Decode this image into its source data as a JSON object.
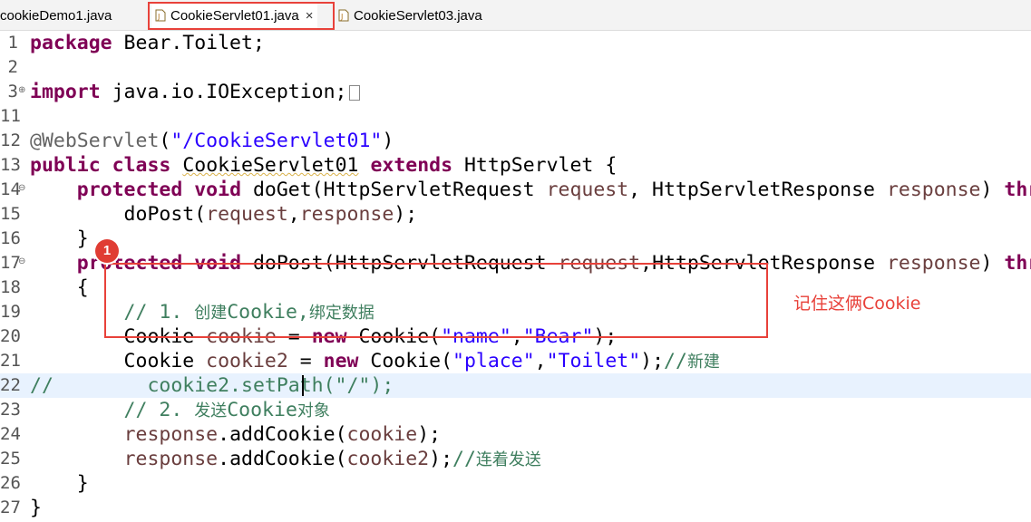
{
  "tabs": [
    {
      "label": "cookieDemo1.java",
      "active": false
    },
    {
      "label": "CookieServlet01.java",
      "active": true,
      "close_glyph": "×"
    },
    {
      "label": "CookieServlet03.java",
      "active": false
    }
  ],
  "editor": {
    "lines": [
      {
        "number": "1",
        "parts": [
          {
            "t": "package",
            "c": "kw"
          },
          {
            "t": " Bear.Toilet;"
          }
        ]
      },
      {
        "number": "2",
        "parts": []
      },
      {
        "number": "3",
        "fold": "⊕",
        "parts": [
          {
            "t": "import",
            "c": "kw"
          },
          {
            "t": " java.io.IOException;"
          }
        ],
        "folded": true
      },
      {
        "number": "11",
        "parts": []
      },
      {
        "number": "12",
        "parts": [
          {
            "t": "@WebServlet",
            "c": "ann"
          },
          {
            "t": "("
          },
          {
            "t": "\"/CookieServlet01\"",
            "c": "str"
          },
          {
            "t": ")"
          }
        ]
      },
      {
        "number": "13",
        "parts": [
          {
            "t": "public",
            "c": "kw"
          },
          {
            "t": " "
          },
          {
            "t": "class",
            "c": "kw"
          },
          {
            "t": " "
          },
          {
            "t": "CookieServlet01",
            "c": "squig"
          },
          {
            "t": " "
          },
          {
            "t": "extends",
            "c": "kw"
          },
          {
            "t": " HttpServlet {"
          }
        ]
      },
      {
        "number": "14",
        "fold": "⊖",
        "parts": [
          {
            "t": "    "
          },
          {
            "t": "protected",
            "c": "kw"
          },
          {
            "t": " "
          },
          {
            "t": "void",
            "c": "kw"
          },
          {
            "t": " doGet(HttpServletRequest "
          },
          {
            "t": "request",
            "c": "var"
          },
          {
            "t": ", HttpServletResponse "
          },
          {
            "t": "response",
            "c": "var"
          },
          {
            "t": ") "
          },
          {
            "t": "throws",
            "c": "kw"
          }
        ]
      },
      {
        "number": "15",
        "parts": [
          {
            "t": "        doPost("
          },
          {
            "t": "request",
            "c": "var"
          },
          {
            "t": ","
          },
          {
            "t": "response",
            "c": "var"
          },
          {
            "t": ");"
          }
        ]
      },
      {
        "number": "16",
        "parts": [
          {
            "t": "    }"
          }
        ]
      },
      {
        "number": "17",
        "fold": "⊖",
        "parts": [
          {
            "t": "    "
          },
          {
            "t": "protected",
            "c": "kw"
          },
          {
            "t": " "
          },
          {
            "t": "void",
            "c": "kw"
          },
          {
            "t": " doPost(HttpServletRequest "
          },
          {
            "t": "request",
            "c": "var"
          },
          {
            "t": ",HttpServletResponse "
          },
          {
            "t": "response",
            "c": "var"
          },
          {
            "t": ") "
          },
          {
            "t": "throws",
            "c": "kw"
          }
        ]
      },
      {
        "number": "18",
        "parts": [
          {
            "t": "    {"
          }
        ]
      },
      {
        "number": "19",
        "parts": [
          {
            "t": "        // 1. ",
            "c": "cm"
          },
          {
            "t": "创建",
            "c": "cm zh"
          },
          {
            "t": "Cookie,",
            "c": "cm"
          },
          {
            "t": "绑定数据",
            "c": "cm zh"
          }
        ]
      },
      {
        "number": "20",
        "parts": [
          {
            "t": "        Cookie "
          },
          {
            "t": "cookie",
            "c": "var"
          },
          {
            "t": " = "
          },
          {
            "t": "new",
            "c": "kw"
          },
          {
            "t": " Cookie("
          },
          {
            "t": "\"name\"",
            "c": "str"
          },
          {
            "t": ","
          },
          {
            "t": "\"Bear\"",
            "c": "str"
          },
          {
            "t": ");"
          }
        ]
      },
      {
        "number": "21",
        "parts": [
          {
            "t": "        Cookie "
          },
          {
            "t": "cookie2",
            "c": "var"
          },
          {
            "t": " = "
          },
          {
            "t": "new",
            "c": "kw"
          },
          {
            "t": " Cookie("
          },
          {
            "t": "\"place\"",
            "c": "str"
          },
          {
            "t": ","
          },
          {
            "t": "\"Toilet\"",
            "c": "str"
          },
          {
            "t": ");"
          },
          {
            "t": "//",
            "c": "cm"
          },
          {
            "t": "新建",
            "c": "cm zh"
          }
        ]
      },
      {
        "number": "22",
        "current": true,
        "parts": [
          {
            "t": "//        cookie2.setPath(\"/\");",
            "c": "cm"
          }
        ]
      },
      {
        "number": "23",
        "parts": [
          {
            "t": "        // 2. ",
            "c": "cm"
          },
          {
            "t": "发送",
            "c": "cm zh"
          },
          {
            "t": "Cookie",
            "c": "cm"
          },
          {
            "t": "对象",
            "c": "cm zh"
          }
        ]
      },
      {
        "number": "24",
        "parts": [
          {
            "t": "        "
          },
          {
            "t": "response",
            "c": "var"
          },
          {
            "t": ".addCookie("
          },
          {
            "t": "cookie",
            "c": "var"
          },
          {
            "t": ");"
          }
        ]
      },
      {
        "number": "25",
        "parts": [
          {
            "t": "        "
          },
          {
            "t": "response",
            "c": "var"
          },
          {
            "t": ".addCookie("
          },
          {
            "t": "cookie2",
            "c": "var"
          },
          {
            "t": ");"
          },
          {
            "t": "//",
            "c": "cm"
          },
          {
            "t": "连着发送",
            "c": "cm zh"
          }
        ]
      },
      {
        "number": "26",
        "parts": [
          {
            "t": "    }"
          }
        ]
      },
      {
        "number": "27",
        "parts": [
          {
            "t": "}"
          }
        ]
      }
    ]
  },
  "annotation": {
    "badge_number": "1",
    "note": "记住这俩Cookie",
    "color": "#e8413a"
  },
  "colors": {
    "keyword": "#7f0055",
    "string": "#2a00ff",
    "comment": "#3f7f5f",
    "variable": "#6a3e3e",
    "current_line": "#e8f2fe"
  }
}
